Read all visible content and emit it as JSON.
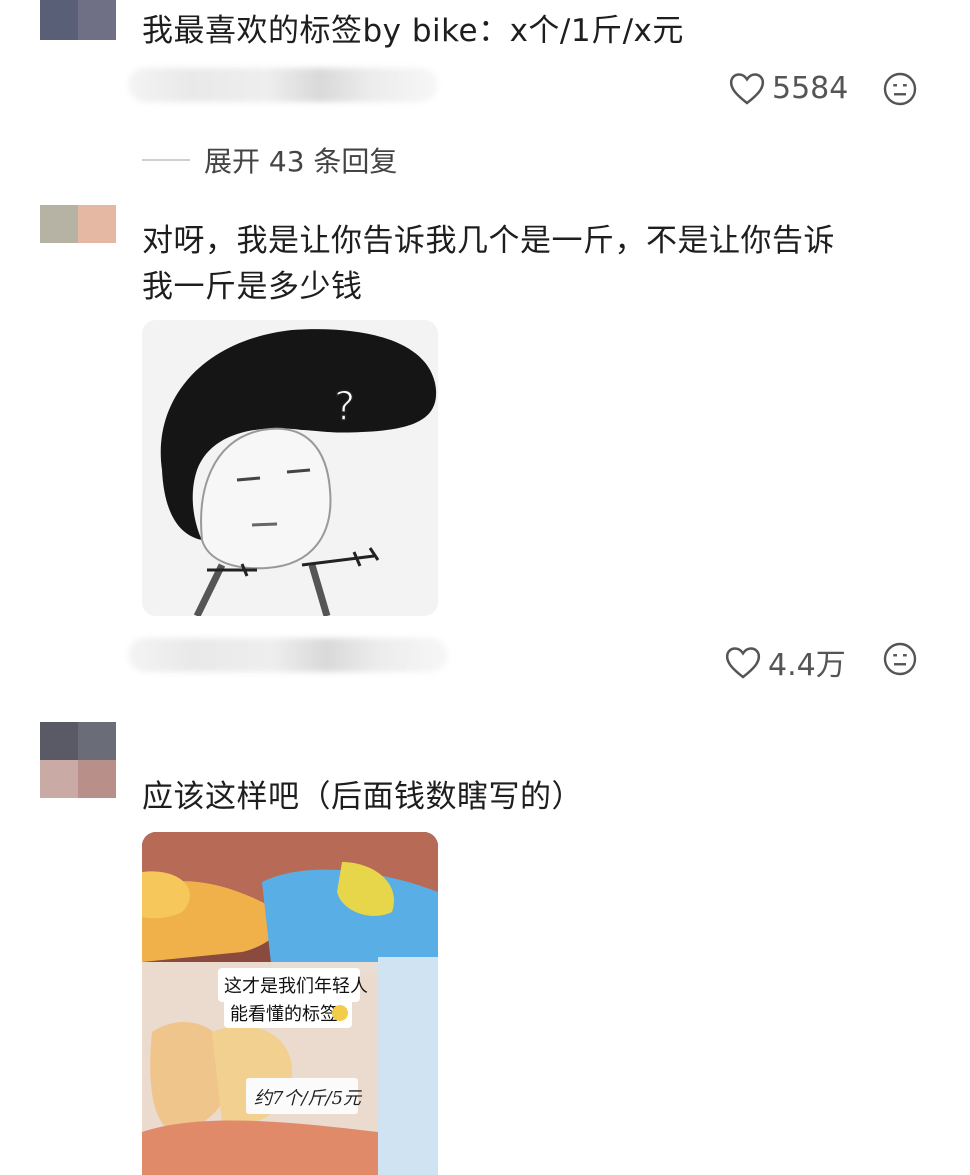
{
  "comments": [
    {
      "text": "我最喜欢的标签by bike：x个/1斤/x元",
      "likes": "5584",
      "like_icon": "heart-outline-icon",
      "react_icon": "meh-face-icon"
    },
    {
      "expand_text": "展开 43 条回复"
    },
    {
      "text_line1": "对呀，我是让你告诉我几个是一斤，不是让你告诉",
      "text_line2": "我一斤是多少钱",
      "image": "confused-meme-drawing",
      "meme_mark": "?",
      "likes": "4.4万",
      "like_icon": "heart-outline-icon",
      "react_icon": "meh-face-icon"
    },
    {
      "text": "应该这样吧（后面钱数瞎写的）",
      "image": "snack-bin-photo",
      "photo_caption_line1": "这才是我们年轻人",
      "photo_caption_line2": "能看懂的标签",
      "photo_label": "约7个/斤/5元"
    }
  ],
  "colors": {
    "text": "#1e1e1e",
    "meta": "#555555",
    "background": "#ffffff"
  }
}
